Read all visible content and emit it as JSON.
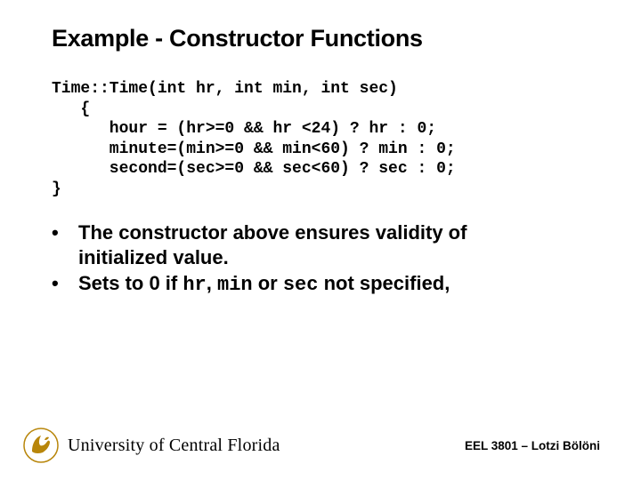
{
  "title": "Example - Constructor Functions",
  "code": "Time::Time(int hr, int min, int sec)\n   {\n      hour = (hr>=0 && hr <24) ? hr : 0;\n      minute=(min>=0 && min<60) ? min : 0;\n      second=(sec>=0 && sec<60) ? sec : 0;\n}",
  "bullets": {
    "b1_a": "The constructor above ensures validity of",
    "b1_b": "initialized value.",
    "b2_a": "Sets to 0 if ",
    "b2_hr": "hr",
    "b2_c1": ", ",
    "b2_min": "min",
    "b2_c2": " or ",
    "b2_sec": "sec",
    "b2_c3": " not specified,"
  },
  "footer": {
    "university": "University of Central Florida",
    "course": "EEL 3801 – Lotzi Bölöni"
  }
}
